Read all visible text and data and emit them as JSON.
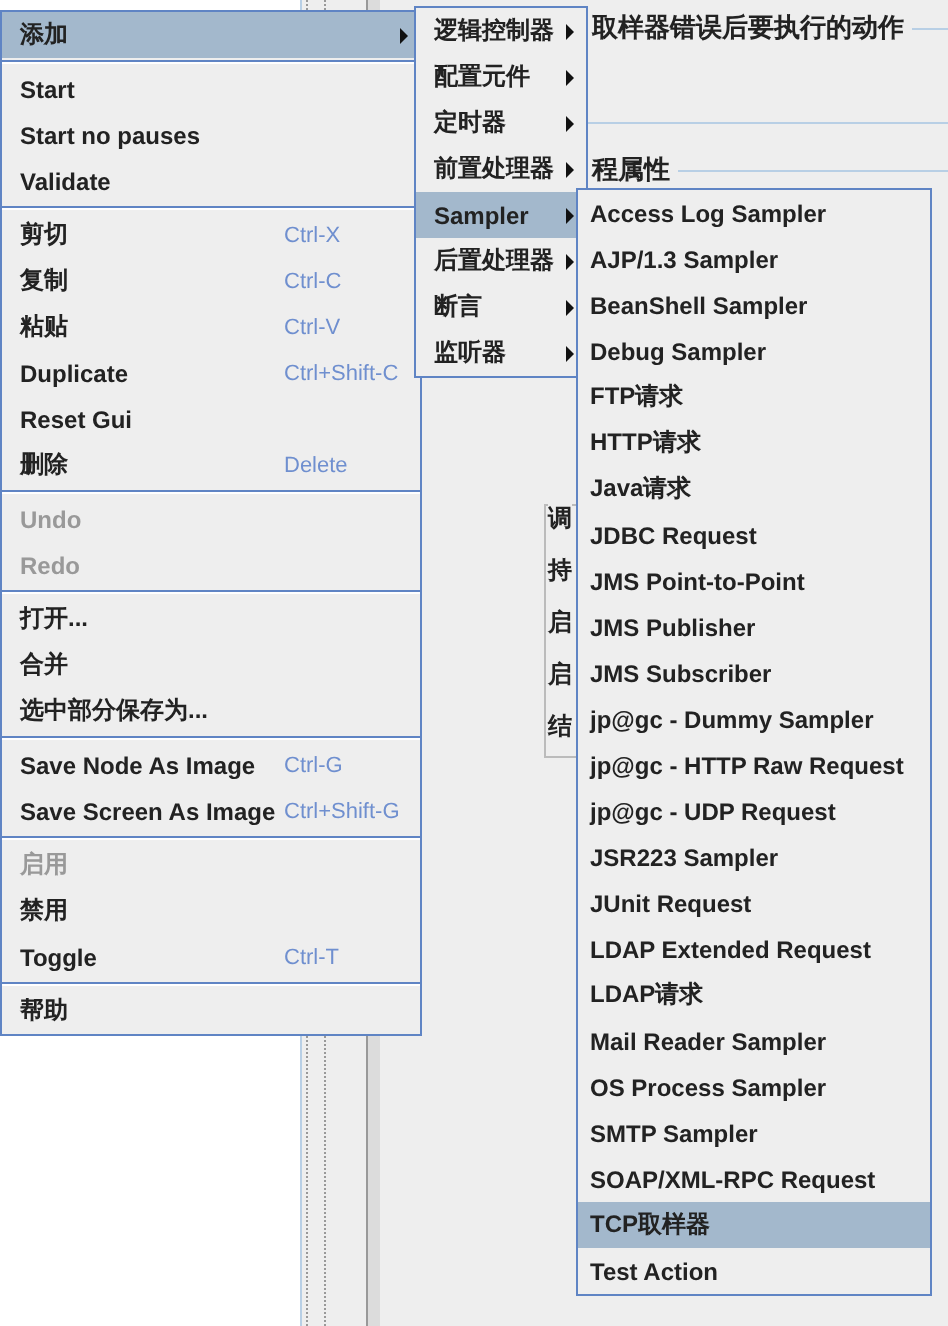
{
  "background": {
    "heading": "取样器错误后要执行的动作",
    "group_title": "程属性",
    "subgroup_title": "调",
    "row_labels": [
      "持",
      "启",
      "启",
      "结"
    ]
  },
  "context_menu": {
    "items": [
      {
        "kind": "item",
        "label": "添加",
        "submenu": true,
        "selected": true,
        "disabled": false
      },
      {
        "kind": "separator"
      },
      {
        "kind": "item",
        "label": "Start",
        "submenu": false,
        "selected": false,
        "disabled": false
      },
      {
        "kind": "item",
        "label": "Start no pauses",
        "submenu": false,
        "selected": false,
        "disabled": false
      },
      {
        "kind": "item",
        "label": "Validate",
        "submenu": false,
        "selected": false,
        "disabled": false
      },
      {
        "kind": "separator"
      },
      {
        "kind": "item",
        "label": "剪切",
        "shortcut": "Ctrl-X",
        "submenu": false,
        "selected": false,
        "disabled": false
      },
      {
        "kind": "item",
        "label": "复制",
        "shortcut": "Ctrl-C",
        "submenu": false,
        "selected": false,
        "disabled": false
      },
      {
        "kind": "item",
        "label": "粘贴",
        "shortcut": "Ctrl-V",
        "submenu": false,
        "selected": false,
        "disabled": false
      },
      {
        "kind": "item",
        "label": "Duplicate",
        "shortcut": "Ctrl+Shift-C",
        "submenu": false,
        "selected": false,
        "disabled": false
      },
      {
        "kind": "item",
        "label": "Reset Gui",
        "submenu": false,
        "selected": false,
        "disabled": false
      },
      {
        "kind": "item",
        "label": "删除",
        "shortcut": "Delete",
        "submenu": false,
        "selected": false,
        "disabled": false
      },
      {
        "kind": "separator"
      },
      {
        "kind": "item",
        "label": "Undo",
        "submenu": false,
        "selected": false,
        "disabled": true
      },
      {
        "kind": "item",
        "label": "Redo",
        "submenu": false,
        "selected": false,
        "disabled": true
      },
      {
        "kind": "separator"
      },
      {
        "kind": "item",
        "label": "打开...",
        "submenu": false,
        "selected": false,
        "disabled": false
      },
      {
        "kind": "item",
        "label": "合并",
        "submenu": false,
        "selected": false,
        "disabled": false
      },
      {
        "kind": "item",
        "label": "选中部分保存为...",
        "submenu": false,
        "selected": false,
        "disabled": false
      },
      {
        "kind": "separator"
      },
      {
        "kind": "item",
        "label": "Save Node As Image",
        "shortcut": "Ctrl-G",
        "submenu": false,
        "selected": false,
        "disabled": false
      },
      {
        "kind": "item",
        "label": "Save Screen As Image",
        "shortcut": "Ctrl+Shift-G",
        "submenu": false,
        "selected": false,
        "disabled": false
      },
      {
        "kind": "separator"
      },
      {
        "kind": "item",
        "label": "启用",
        "submenu": false,
        "selected": false,
        "disabled": true
      },
      {
        "kind": "item",
        "label": "禁用",
        "submenu": false,
        "selected": false,
        "disabled": false
      },
      {
        "kind": "item",
        "label": "Toggle",
        "shortcut": "Ctrl-T",
        "submenu": false,
        "selected": false,
        "disabled": false
      },
      {
        "kind": "separator"
      },
      {
        "kind": "item",
        "label": "帮助",
        "submenu": false,
        "selected": false,
        "disabled": false
      }
    ]
  },
  "add_submenu": {
    "items": [
      {
        "label": "逻辑控制器",
        "submenu": true,
        "selected": false
      },
      {
        "label": "配置元件",
        "submenu": true,
        "selected": false
      },
      {
        "label": "定时器",
        "submenu": true,
        "selected": false
      },
      {
        "label": "前置处理器",
        "submenu": true,
        "selected": false
      },
      {
        "label": "Sampler",
        "submenu": true,
        "selected": true
      },
      {
        "label": "后置处理器",
        "submenu": true,
        "selected": false
      },
      {
        "label": "断言",
        "submenu": true,
        "selected": false
      },
      {
        "label": "监听器",
        "submenu": true,
        "selected": false
      }
    ]
  },
  "sampler_submenu": {
    "items": [
      {
        "label": "Access Log Sampler",
        "selected": false
      },
      {
        "label": "AJP/1.3 Sampler",
        "selected": false
      },
      {
        "label": "BeanShell Sampler",
        "selected": false
      },
      {
        "label": "Debug Sampler",
        "selected": false
      },
      {
        "label": "FTP请求",
        "selected": false
      },
      {
        "label": "HTTP请求",
        "selected": false
      },
      {
        "label": "Java请求",
        "selected": false
      },
      {
        "label": "JDBC Request",
        "selected": false
      },
      {
        "label": "JMS Point-to-Point",
        "selected": false
      },
      {
        "label": "JMS Publisher",
        "selected": false
      },
      {
        "label": "JMS Subscriber",
        "selected": false
      },
      {
        "label": "jp@gc - Dummy Sampler",
        "selected": false
      },
      {
        "label": "jp@gc - HTTP Raw Request",
        "selected": false
      },
      {
        "label": "jp@gc - UDP Request",
        "selected": false
      },
      {
        "label": "JSR223 Sampler",
        "selected": false
      },
      {
        "label": "JUnit Request",
        "selected": false
      },
      {
        "label": "LDAP Extended Request",
        "selected": false
      },
      {
        "label": "LDAP请求",
        "selected": false
      },
      {
        "label": "Mail Reader Sampler",
        "selected": false
      },
      {
        "label": "OS Process Sampler",
        "selected": false
      },
      {
        "label": "SMTP Sampler",
        "selected": false
      },
      {
        "label": "SOAP/XML-RPC Request",
        "selected": false
      },
      {
        "label": "TCP取样器",
        "selected": true
      },
      {
        "label": "Test Action",
        "selected": false
      }
    ]
  }
}
